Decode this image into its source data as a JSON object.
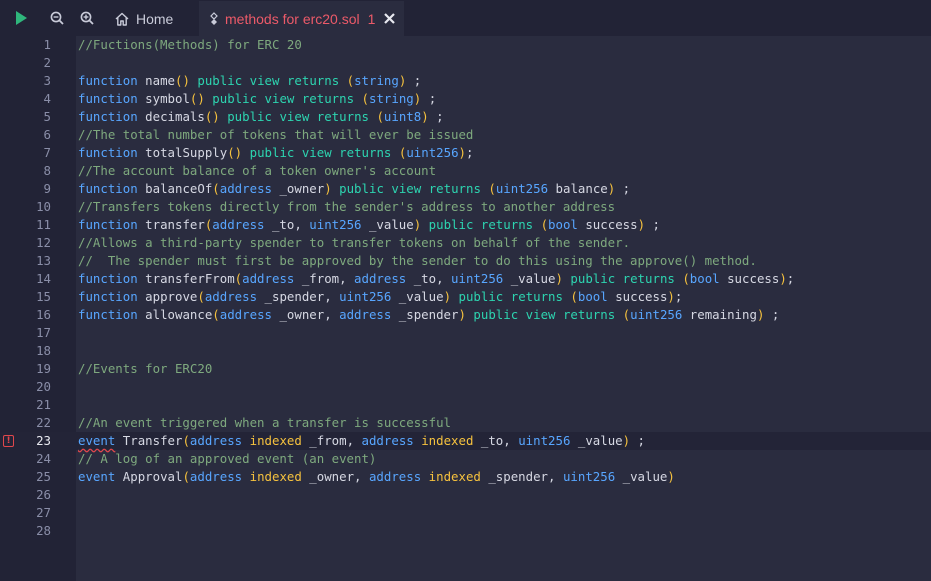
{
  "toolbar": {
    "run_icon": "play-icon",
    "zoom_out_icon": "zoom-out-icon",
    "zoom_in_icon": "zoom-in-icon"
  },
  "tabs": [
    {
      "label": "Home",
      "icon": "home-icon",
      "active": false
    },
    {
      "label": "methods for erc20.sol",
      "icon": "solidity-icon",
      "badge": "1",
      "close_icon": "close-icon",
      "active": true
    }
  ],
  "colors": {
    "accent_error": "#ec5a69",
    "keyword": "#58a6ff",
    "modifier": "#2dd4b0",
    "comment": "#7ea97e",
    "paren": "#f6c23e",
    "background": "#2a2c3f"
  },
  "editor": {
    "current_line": 23,
    "error_line": 23,
    "lines": [
      {
        "n": "1",
        "tokens": [
          {
            "t": "//Fuctions(Methods) for ERC 20",
            "c": "comment"
          }
        ]
      },
      {
        "n": "2",
        "tokens": []
      },
      {
        "n": "3",
        "tokens": [
          {
            "t": "function",
            "c": "kw"
          },
          {
            "t": " name",
            "c": "plain"
          },
          {
            "t": "()",
            "c": "paren"
          },
          {
            "t": " ",
            "c": "plain"
          },
          {
            "t": "public",
            "c": "vis"
          },
          {
            "t": " ",
            "c": "plain"
          },
          {
            "t": "view",
            "c": "vis"
          },
          {
            "t": " ",
            "c": "plain"
          },
          {
            "t": "returns",
            "c": "vis"
          },
          {
            "t": " ",
            "c": "plain"
          },
          {
            "t": "(",
            "c": "paren"
          },
          {
            "t": "string",
            "c": "type"
          },
          {
            "t": ")",
            "c": "paren"
          },
          {
            "t": " ;",
            "c": "plain"
          }
        ]
      },
      {
        "n": "4",
        "tokens": [
          {
            "t": "function",
            "c": "kw"
          },
          {
            "t": " symbol",
            "c": "plain"
          },
          {
            "t": "()",
            "c": "paren"
          },
          {
            "t": " ",
            "c": "plain"
          },
          {
            "t": "public",
            "c": "vis"
          },
          {
            "t": " ",
            "c": "plain"
          },
          {
            "t": "view",
            "c": "vis"
          },
          {
            "t": " ",
            "c": "plain"
          },
          {
            "t": "returns",
            "c": "vis"
          },
          {
            "t": " ",
            "c": "plain"
          },
          {
            "t": "(",
            "c": "paren"
          },
          {
            "t": "string",
            "c": "type"
          },
          {
            "t": ")",
            "c": "paren"
          },
          {
            "t": " ;",
            "c": "plain"
          }
        ]
      },
      {
        "n": "5",
        "tokens": [
          {
            "t": "function",
            "c": "kw"
          },
          {
            "t": " decimals",
            "c": "plain"
          },
          {
            "t": "()",
            "c": "paren"
          },
          {
            "t": " ",
            "c": "plain"
          },
          {
            "t": "public",
            "c": "vis"
          },
          {
            "t": " ",
            "c": "plain"
          },
          {
            "t": "view",
            "c": "vis"
          },
          {
            "t": " ",
            "c": "plain"
          },
          {
            "t": "returns",
            "c": "vis"
          },
          {
            "t": " ",
            "c": "plain"
          },
          {
            "t": "(",
            "c": "paren"
          },
          {
            "t": "uint8",
            "c": "type"
          },
          {
            "t": ")",
            "c": "paren"
          },
          {
            "t": " ;",
            "c": "plain"
          }
        ]
      },
      {
        "n": "6",
        "tokens": [
          {
            "t": "//The total number of tokens that will ever be issued",
            "c": "comment"
          }
        ]
      },
      {
        "n": "7",
        "tokens": [
          {
            "t": "function",
            "c": "kw"
          },
          {
            "t": " totalSupply",
            "c": "plain"
          },
          {
            "t": "()",
            "c": "paren"
          },
          {
            "t": " ",
            "c": "plain"
          },
          {
            "t": "public",
            "c": "vis"
          },
          {
            "t": " ",
            "c": "plain"
          },
          {
            "t": "view",
            "c": "vis"
          },
          {
            "t": " ",
            "c": "plain"
          },
          {
            "t": "returns",
            "c": "vis"
          },
          {
            "t": " ",
            "c": "plain"
          },
          {
            "t": "(",
            "c": "paren"
          },
          {
            "t": "uint256",
            "c": "type"
          },
          {
            "t": ")",
            "c": "paren"
          },
          {
            "t": ";",
            "c": "plain"
          }
        ]
      },
      {
        "n": "8",
        "tokens": [
          {
            "t": "//The account balance of a token owner's account",
            "c": "comment"
          }
        ]
      },
      {
        "n": "9",
        "tokens": [
          {
            "t": "function",
            "c": "kw"
          },
          {
            "t": " balanceOf",
            "c": "plain"
          },
          {
            "t": "(",
            "c": "paren"
          },
          {
            "t": "address",
            "c": "type"
          },
          {
            "t": " _owner",
            "c": "plain"
          },
          {
            "t": ")",
            "c": "paren"
          },
          {
            "t": " ",
            "c": "plain"
          },
          {
            "t": "public",
            "c": "vis"
          },
          {
            "t": " ",
            "c": "plain"
          },
          {
            "t": "view",
            "c": "vis"
          },
          {
            "t": " ",
            "c": "plain"
          },
          {
            "t": "returns",
            "c": "vis"
          },
          {
            "t": " ",
            "c": "plain"
          },
          {
            "t": "(",
            "c": "paren"
          },
          {
            "t": "uint256",
            "c": "type"
          },
          {
            "t": " balance",
            "c": "plain"
          },
          {
            "t": ")",
            "c": "paren"
          },
          {
            "t": " ;",
            "c": "plain"
          }
        ]
      },
      {
        "n": "10",
        "tokens": [
          {
            "t": "//Transfers tokens directly from the sender's address to another address",
            "c": "comment"
          }
        ]
      },
      {
        "n": "11",
        "tokens": [
          {
            "t": "function",
            "c": "kw"
          },
          {
            "t": " transfer",
            "c": "plain"
          },
          {
            "t": "(",
            "c": "paren"
          },
          {
            "t": "address",
            "c": "type"
          },
          {
            "t": " _to, ",
            "c": "plain"
          },
          {
            "t": "uint256",
            "c": "type"
          },
          {
            "t": " _value",
            "c": "plain"
          },
          {
            "t": ")",
            "c": "paren"
          },
          {
            "t": " ",
            "c": "plain"
          },
          {
            "t": "public",
            "c": "vis"
          },
          {
            "t": " ",
            "c": "plain"
          },
          {
            "t": "returns",
            "c": "vis"
          },
          {
            "t": " ",
            "c": "plain"
          },
          {
            "t": "(",
            "c": "paren"
          },
          {
            "t": "bool",
            "c": "type"
          },
          {
            "t": " success",
            "c": "plain"
          },
          {
            "t": ")",
            "c": "paren"
          },
          {
            "t": " ;",
            "c": "plain"
          }
        ]
      },
      {
        "n": "12",
        "tokens": [
          {
            "t": "//Allows a third-party spender to transfer tokens on behalf of the sender.",
            "c": "comment"
          }
        ]
      },
      {
        "n": "13",
        "tokens": [
          {
            "t": "//  The spender must first be approved by the sender to do this using the approve() method.",
            "c": "comment"
          }
        ]
      },
      {
        "n": "14",
        "tokens": [
          {
            "t": "function",
            "c": "kw"
          },
          {
            "t": " transferFrom",
            "c": "plain"
          },
          {
            "t": "(",
            "c": "paren"
          },
          {
            "t": "address",
            "c": "type"
          },
          {
            "t": " _from, ",
            "c": "plain"
          },
          {
            "t": "address",
            "c": "type"
          },
          {
            "t": " _to, ",
            "c": "plain"
          },
          {
            "t": "uint256",
            "c": "type"
          },
          {
            "t": " _value",
            "c": "plain"
          },
          {
            "t": ")",
            "c": "paren"
          },
          {
            "t": " ",
            "c": "plain"
          },
          {
            "t": "public",
            "c": "vis"
          },
          {
            "t": " ",
            "c": "plain"
          },
          {
            "t": "returns",
            "c": "vis"
          },
          {
            "t": " ",
            "c": "plain"
          },
          {
            "t": "(",
            "c": "paren"
          },
          {
            "t": "bool",
            "c": "type"
          },
          {
            "t": " success",
            "c": "plain"
          },
          {
            "t": ")",
            "c": "paren"
          },
          {
            "t": ";",
            "c": "plain"
          }
        ]
      },
      {
        "n": "15",
        "tokens": [
          {
            "t": "function",
            "c": "kw"
          },
          {
            "t": " approve",
            "c": "plain"
          },
          {
            "t": "(",
            "c": "paren"
          },
          {
            "t": "address",
            "c": "type"
          },
          {
            "t": " _spender, ",
            "c": "plain"
          },
          {
            "t": "uint256",
            "c": "type"
          },
          {
            "t": " _value",
            "c": "plain"
          },
          {
            "t": ")",
            "c": "paren"
          },
          {
            "t": " ",
            "c": "plain"
          },
          {
            "t": "public",
            "c": "vis"
          },
          {
            "t": " ",
            "c": "plain"
          },
          {
            "t": "returns",
            "c": "vis"
          },
          {
            "t": " ",
            "c": "plain"
          },
          {
            "t": "(",
            "c": "paren"
          },
          {
            "t": "bool",
            "c": "type"
          },
          {
            "t": " success",
            "c": "plain"
          },
          {
            "t": ")",
            "c": "paren"
          },
          {
            "t": ";",
            "c": "plain"
          }
        ]
      },
      {
        "n": "16",
        "tokens": [
          {
            "t": "function",
            "c": "kw"
          },
          {
            "t": " allowance",
            "c": "plain"
          },
          {
            "t": "(",
            "c": "paren"
          },
          {
            "t": "address",
            "c": "type"
          },
          {
            "t": " _owner, ",
            "c": "plain"
          },
          {
            "t": "address",
            "c": "type"
          },
          {
            "t": " _spender",
            "c": "plain"
          },
          {
            "t": ")",
            "c": "paren"
          },
          {
            "t": " ",
            "c": "plain"
          },
          {
            "t": "public",
            "c": "vis"
          },
          {
            "t": " ",
            "c": "plain"
          },
          {
            "t": "view",
            "c": "vis"
          },
          {
            "t": " ",
            "c": "plain"
          },
          {
            "t": "returns",
            "c": "vis"
          },
          {
            "t": " ",
            "c": "plain"
          },
          {
            "t": "(",
            "c": "paren"
          },
          {
            "t": "uint256",
            "c": "type"
          },
          {
            "t": " remaining",
            "c": "plain"
          },
          {
            "t": ")",
            "c": "paren"
          },
          {
            "t": " ;",
            "c": "plain"
          }
        ]
      },
      {
        "n": "17",
        "tokens": []
      },
      {
        "n": "18",
        "tokens": []
      },
      {
        "n": "19",
        "tokens": [
          {
            "t": "//Events for ERC20",
            "c": "comment"
          }
        ]
      },
      {
        "n": "20",
        "tokens": []
      },
      {
        "n": "21",
        "tokens": []
      },
      {
        "n": "22",
        "tokens": [
          {
            "t": "//An event triggered when a transfer is successful",
            "c": "comment"
          }
        ]
      },
      {
        "n": "23",
        "tokens": [
          {
            "t": "event",
            "c": "kw",
            "err": true
          },
          {
            "t": " Transfer",
            "c": "plain"
          },
          {
            "t": "(",
            "c": "paren"
          },
          {
            "t": "address",
            "c": "type"
          },
          {
            "t": " ",
            "c": "plain"
          },
          {
            "t": "indexed",
            "c": "indexed"
          },
          {
            "t": " _from, ",
            "c": "plain"
          },
          {
            "t": "address",
            "c": "type"
          },
          {
            "t": " ",
            "c": "plain"
          },
          {
            "t": "indexed",
            "c": "indexed"
          },
          {
            "t": " _to, ",
            "c": "plain"
          },
          {
            "t": "uint256",
            "c": "type"
          },
          {
            "t": " _value",
            "c": "plain"
          },
          {
            "t": ")",
            "c": "paren"
          },
          {
            "t": " ;",
            "c": "plain"
          }
        ]
      },
      {
        "n": "24",
        "tokens": [
          {
            "t": "// A log of an approved event (an event)",
            "c": "comment"
          }
        ]
      },
      {
        "n": "25",
        "tokens": [
          {
            "t": "event",
            "c": "kw"
          },
          {
            "t": " Approval",
            "c": "plain"
          },
          {
            "t": "(",
            "c": "paren"
          },
          {
            "t": "address",
            "c": "type"
          },
          {
            "t": " ",
            "c": "plain"
          },
          {
            "t": "indexed",
            "c": "indexed"
          },
          {
            "t": " _owner, ",
            "c": "plain"
          },
          {
            "t": "address",
            "c": "type"
          },
          {
            "t": " ",
            "c": "plain"
          },
          {
            "t": "indexed",
            "c": "indexed"
          },
          {
            "t": " _spender, ",
            "c": "plain"
          },
          {
            "t": "uint256",
            "c": "type"
          },
          {
            "t": " _value",
            "c": "plain"
          },
          {
            "t": ")",
            "c": "paren"
          }
        ]
      },
      {
        "n": "26",
        "tokens": []
      },
      {
        "n": "27",
        "tokens": []
      },
      {
        "n": "28",
        "tokens": []
      }
    ]
  }
}
